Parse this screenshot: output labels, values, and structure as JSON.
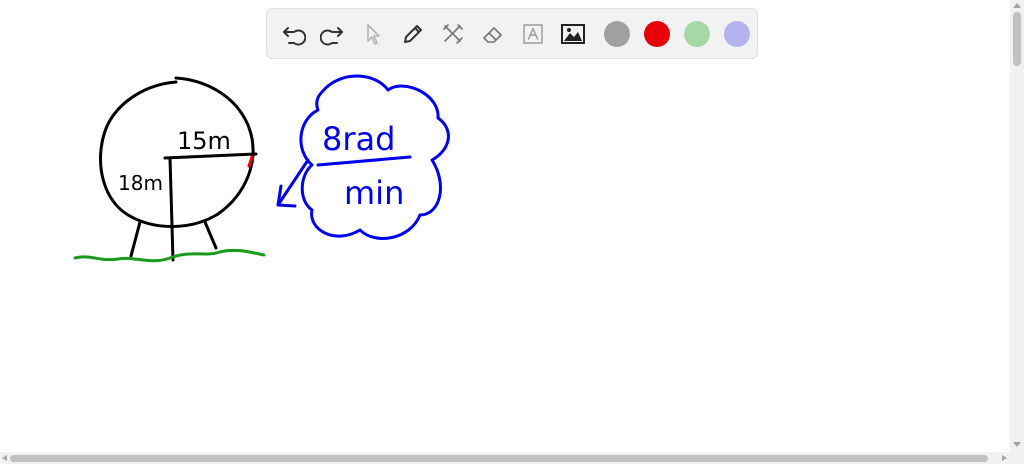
{
  "toolbar": {
    "tools": [
      "undo-icon",
      "redo-icon",
      "select-pointer-icon",
      "pen-icon",
      "tools-icon",
      "eraser-icon",
      "text-icon",
      "image-icon"
    ],
    "colors": [
      "#a0a0a0",
      "#e8000b",
      "#a6d8a6",
      "#b3b3ef"
    ]
  },
  "drawing": {
    "radius_label": "15m",
    "height_label": "18m",
    "rate_numerator": "8rad",
    "rate_denominator": "min",
    "ink_colors": {
      "black": "#000000",
      "blue": "#0000ee",
      "green": "#1a9a1a",
      "red": "#e8000b"
    }
  }
}
